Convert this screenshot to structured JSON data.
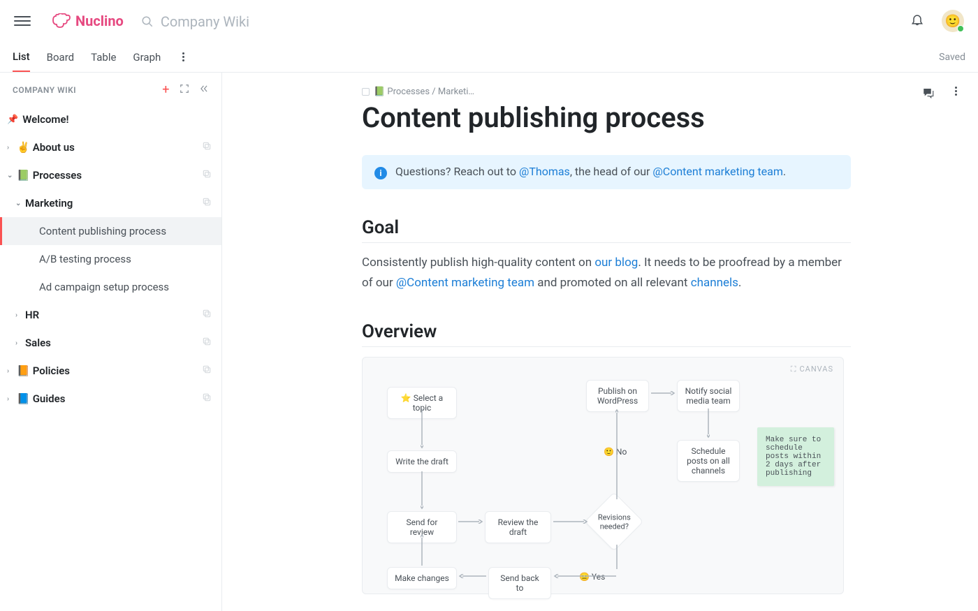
{
  "app": {
    "name": "Nuclino",
    "search_placeholder": "Company Wiki"
  },
  "tabs": {
    "list": "List",
    "board": "Board",
    "table": "Table",
    "graph": "Graph",
    "saved": "Saved"
  },
  "sidebar": {
    "title": "COMPANY WIKI",
    "welcome": "Welcome!",
    "about": "About us",
    "processes": "Processes",
    "marketing": "Marketing",
    "items": {
      "content_publishing": "Content publishing process",
      "ab_testing": "A/B testing process",
      "ad_campaign": "Ad campaign setup process"
    },
    "hr": "HR",
    "sales": "Sales",
    "policies": "Policies",
    "guides": "Guides"
  },
  "doc": {
    "breadcrumb_parent": "📗 Processes / Marketi…",
    "title": "Content publishing process",
    "callout": {
      "prefix": "Questions? Reach out to ",
      "mention1": "@Thomas",
      "mid": ", the head of our ",
      "mention2": "@Content marketing team",
      "suffix": "."
    },
    "goal_heading": "Goal",
    "goal": {
      "t1": "Consistently publish high-quality content on ",
      "l1": "our blog",
      "t2": ". It needs to be proofread by a  member of our ",
      "l2": "@Content marketing team",
      "t3": " and promoted on all relevant ",
      "l3": "channels",
      "t4": "."
    },
    "overview_heading": "Overview",
    "canvas_label": "CANVAS",
    "nodes": {
      "select_topic": "⭐ Select a topic",
      "write_draft": "Write the draft",
      "send_review": "Send for review",
      "review_draft": "Review the draft",
      "revisions": "Revisions needed?",
      "no": "🙂 No",
      "yes": "😐 Yes",
      "publish": "Publish on WordPress",
      "notify": "Notify social media team",
      "schedule": "Schedule posts on all channels",
      "make_changes": "Make changes",
      "send_back": "Send back to",
      "sticky": "Make sure to schedule posts within 2 days after publishing"
    }
  }
}
